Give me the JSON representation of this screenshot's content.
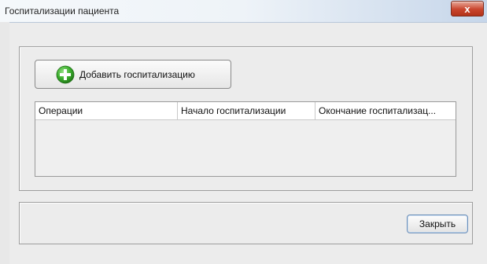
{
  "window": {
    "title": "Госпитализации пациента",
    "close_glyph": "x"
  },
  "toolbar": {
    "add_label": "Добавить госпитализацию",
    "add_icon": "plus-circle-icon",
    "add_icon_color": "#3cae2e"
  },
  "table": {
    "columns": [
      "Операции",
      "Начало госпитализации",
      "Окончание госпитализац..."
    ],
    "rows": []
  },
  "footer": {
    "close_label": "Закрыть"
  },
  "colors": {
    "close_button_red": "#c9452d",
    "focus_border": "#6c8fb8"
  }
}
